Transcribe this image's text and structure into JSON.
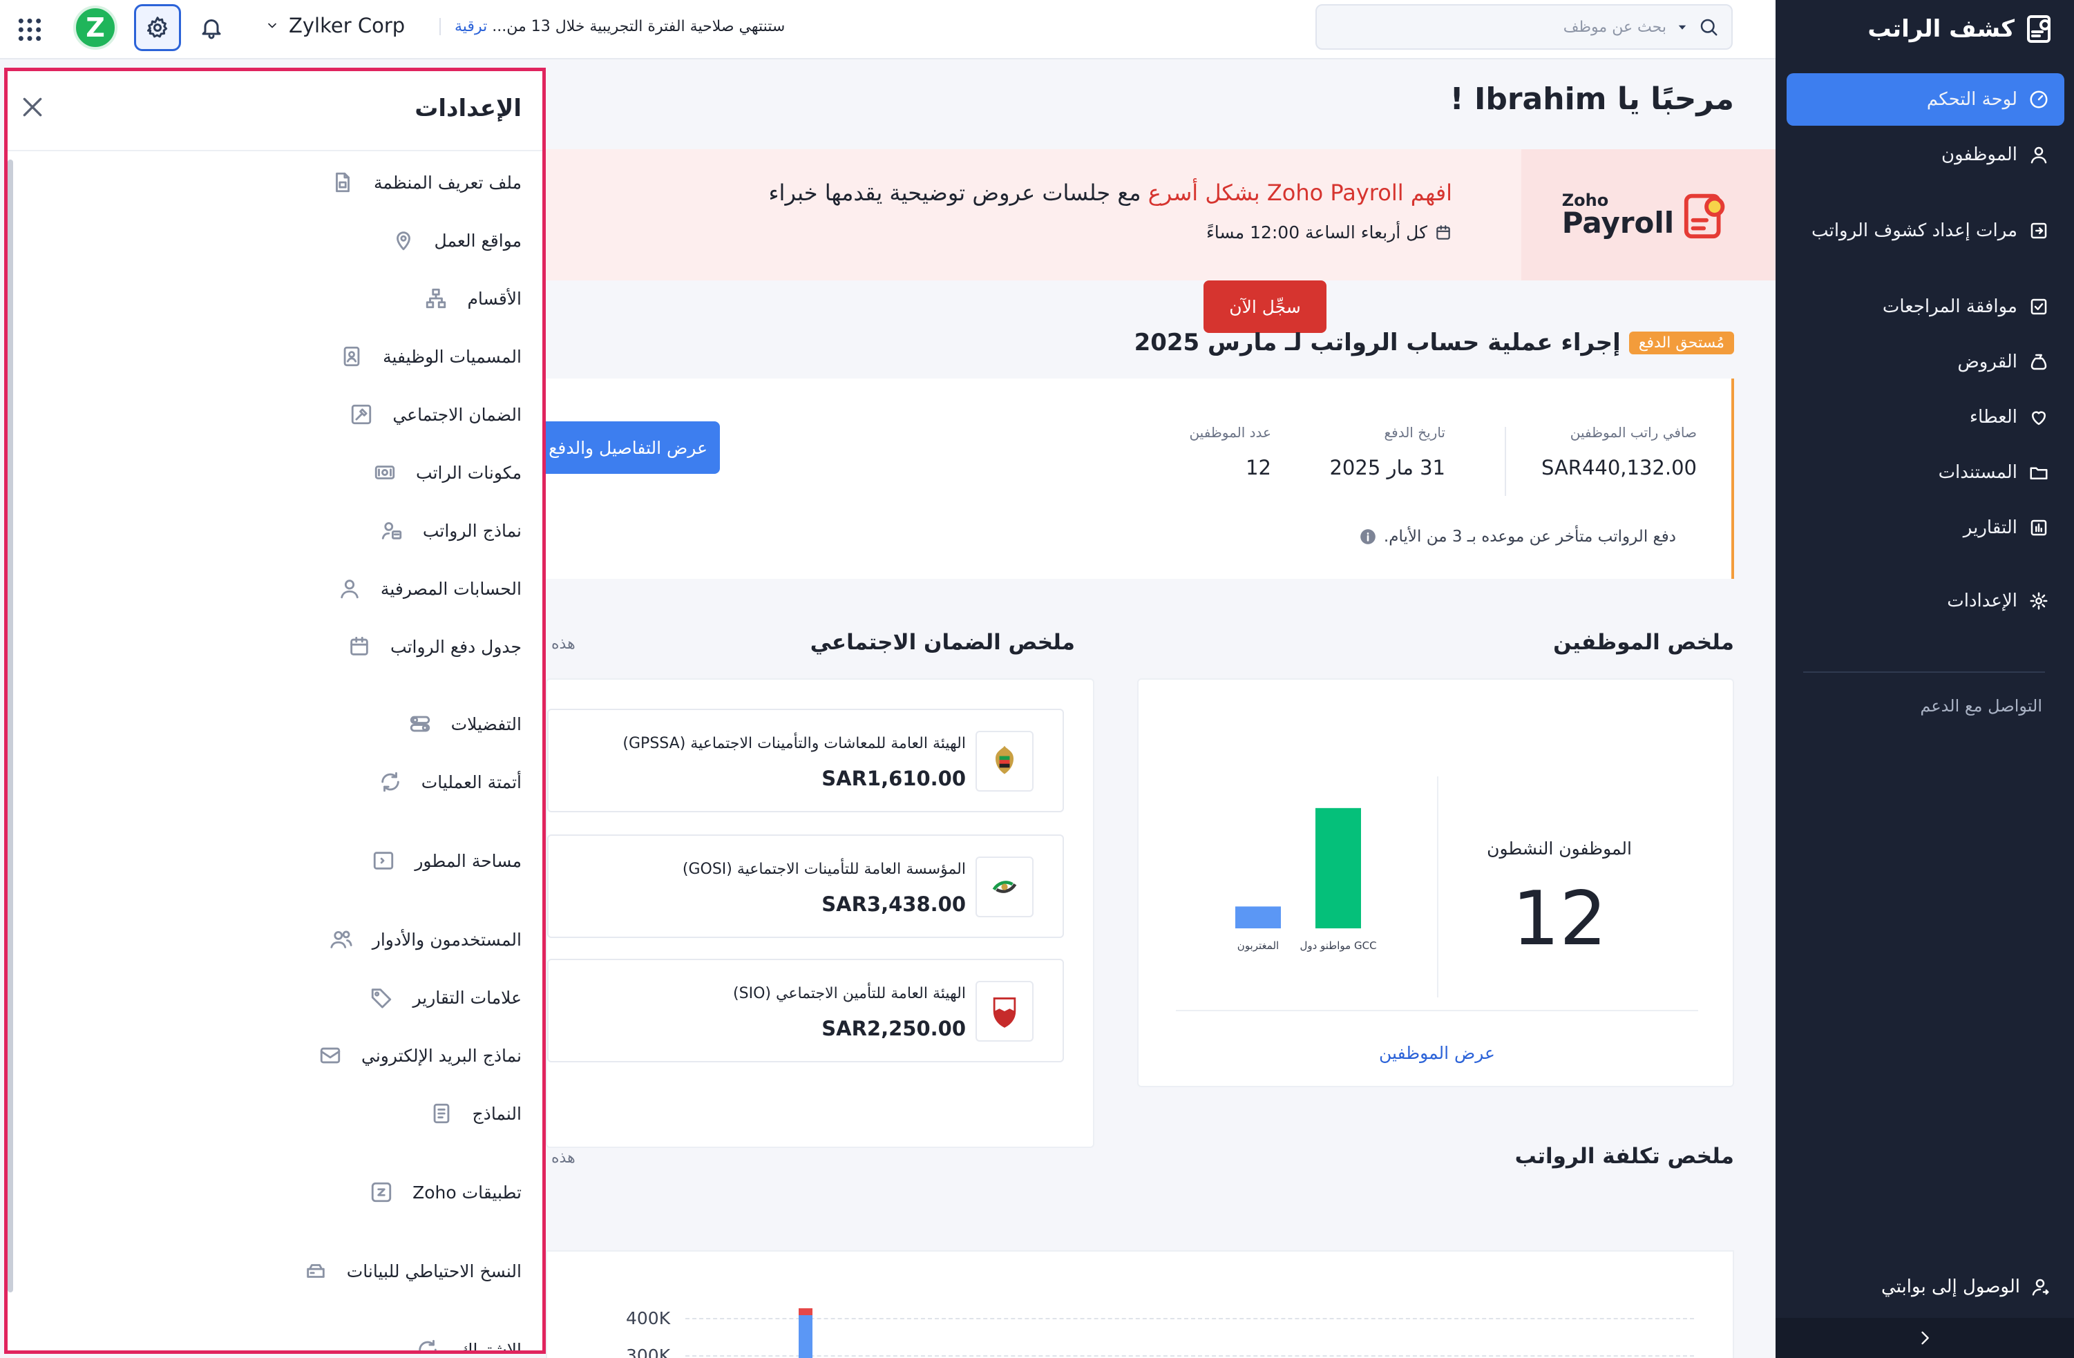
{
  "sidebar": {
    "brand": "كشف الراتب",
    "items": [
      {
        "label": "لوحة التحكم",
        "icon": "dashboard-icon"
      },
      {
        "label": "الموظفون",
        "icon": "user-icon"
      },
      {
        "label": "مرات إعداد كشوف الرواتب",
        "icon": "run-icon"
      },
      {
        "label": "موافقة المراجعات",
        "icon": "approval-icon"
      },
      {
        "label": "القروض",
        "icon": "loan-icon"
      },
      {
        "label": "العطاء",
        "icon": "heart-icon"
      },
      {
        "label": "المستندات",
        "icon": "folder-icon"
      },
      {
        "label": "التقارير",
        "icon": "reports-icon"
      },
      {
        "label": "الإعدادات",
        "icon": "gear-icon"
      }
    ],
    "support": "التواصل مع الدعم",
    "portal": "الوصول إلى بوابتي"
  },
  "topbar": {
    "org_initial": "Z",
    "org_name": "Zylker Corp",
    "trial_text": "ستنتهي صلاحية الفترة التجريبية خلال 13 من...",
    "upgrade": "ترقية",
    "search_placeholder": "بحث عن موظف"
  },
  "main": {
    "welcome": "مرحبًا يا Ibrahim !",
    "banner": {
      "logo_zoho": "Zoho",
      "logo_payroll": "Payroll",
      "text_prefix": "افهم Zoho Payroll",
      "text_highlight": " بشكل أسرع ",
      "text_suffix": "مع جلسات عروض توضيحية يقدمها خبراء",
      "schedule": "كل أربعاء الساعة 12:00 مساءً",
      "register": "سجِّل الآن"
    },
    "payrun": {
      "title": "إجراء عملية حساب الرواتب لـ مارس 2025",
      "badge": "مُستحق الدفع",
      "net_pay_label": "صافي راتب الموظفين",
      "net_pay": "SAR440,132.00",
      "pay_date_label": "تاريخ الدفع",
      "pay_date": "31 مار 2025",
      "emp_count_label": "عدد الموظفين",
      "emp_count": "12",
      "note": "دفع الرواتب متأخر عن موعده بـ 3 من الأيام.",
      "view_button": "عرض التفاصيل والدفع"
    },
    "employee_summary": {
      "title": "ملخص الموظفين",
      "active_label": "الموظفون النشطون",
      "active_count": "12",
      "view_link": "عرض الموظفين"
    },
    "social_security": {
      "title": "ملخص الضمان الاجتماعي",
      "period_hint": "هذه",
      "items": [
        {
          "name": "الهيئة العامة للمعاشات والتأمينات الاجتماعية (GPSSA)",
          "amount": "SAR1,610.00",
          "icon": "uae-emblem-icon"
        },
        {
          "name": "المؤسسة العامة للتأمينات الاجتماعية (GOSI)",
          "amount": "SAR3,438.00",
          "icon": "gosi-logo-icon"
        },
        {
          "name": "الهيئة العامة للتأمين الاجتماعي (SIO)",
          "amount": "SAR2,250.00",
          "icon": "bahrain-emblem-icon"
        }
      ]
    },
    "payroll_cost": {
      "title": "ملخص تكلفة الرواتب",
      "period_hint": "هذه"
    }
  },
  "chart_data": [
    {
      "type": "bar",
      "categories": [
        "مواطنو دول GCC",
        "المغتربون"
      ],
      "values": [
        11,
        2
      ],
      "colors": [
        "#05c07a",
        "#5b97f5"
      ],
      "ylim": [
        0,
        12
      ],
      "grid": false
    },
    {
      "type": "bar",
      "stacked": true,
      "ytick_labels": [
        "400K",
        "300K"
      ],
      "colors": [
        "#e54848",
        "#5b97f5",
        "#05b36a"
      ],
      "grid": true
    }
  ],
  "settings_panel": {
    "title": "الإعدادات",
    "items": [
      {
        "label": "ملف تعريف المنظمة",
        "icon": "org-profile-icon"
      },
      {
        "label": "مواقع العمل",
        "icon": "location-pin-icon"
      },
      {
        "label": "الأقسام",
        "icon": "hierarchy-icon"
      },
      {
        "label": "المسميات الوظيفية",
        "icon": "id-badge-icon"
      },
      {
        "label": "الضمان الاجتماعي",
        "icon": "shield-tool-icon"
      },
      {
        "label": "مكونات الراتب",
        "icon": "money-icon"
      },
      {
        "label": "نماذج الرواتب",
        "icon": "user-template-icon"
      },
      {
        "label": "الحسابات المصرفية",
        "icon": "bank-user-icon"
      },
      {
        "label": "جدول دفع الرواتب",
        "icon": "calendar-icon"
      },
      {
        "label": "التفضيلات",
        "icon": "toggles-icon"
      },
      {
        "label": "أتمتة العمليات",
        "icon": "refresh-icon"
      },
      {
        "label": "مساحة المطور",
        "icon": "code-icon"
      },
      {
        "label": "المستخدمون والأدوار",
        "icon": "users-icon"
      },
      {
        "label": "علامات التقارير",
        "icon": "tag-icon"
      },
      {
        "label": "نماذج البريد الإلكتروني",
        "icon": "mail-icon"
      },
      {
        "label": "النماذج",
        "icon": "document-icon"
      },
      {
        "label": "تطبيقات Zoho",
        "icon": "zoho-apps-icon"
      },
      {
        "label": "النسخ الاحتياطي للبيانات",
        "icon": "backup-icon"
      },
      {
        "label": "الاشتراك",
        "icon": "subscription-icon"
      }
    ]
  }
}
